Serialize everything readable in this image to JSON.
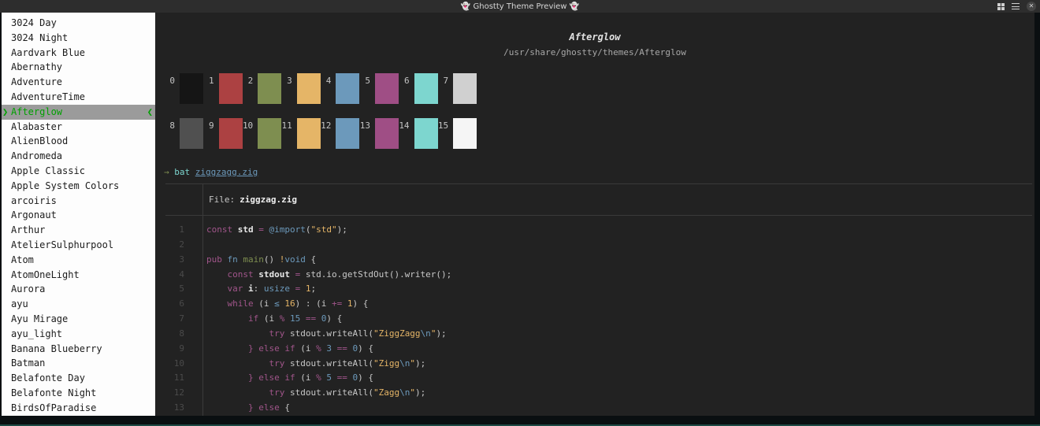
{
  "titlebar": {
    "title": "👻 Ghostty Theme Preview 👻"
  },
  "colors": {
    "titlebar_bg": "#2d2d2d",
    "sidebar_bg": "#fdfdfd",
    "term_bg": "#222222",
    "select_bg": "#9b9b9b",
    "select_green": "#00a000",
    "rule": "#3a3a3a",
    "line_number": "#4a4a4a",
    "plain": "#c8c8c8",
    "bright": "#e8e8e8",
    "magenta": "#a0558a",
    "blue": "#6c99bb",
    "yellow": "#e5b567",
    "green": "#7e8e50",
    "cyan": "#7dd6cf"
  },
  "sidebar": {
    "selected_index": 6,
    "selection_marker_left": "❯",
    "selection_marker_right": "❮",
    "items": [
      "3024 Day",
      "3024 Night",
      "Aardvark Blue",
      "Abernathy",
      "Adventure",
      "AdventureTime",
      "Afterglow",
      "Alabaster",
      "AlienBlood",
      "Andromeda",
      "Apple Classic",
      "Apple System Colors",
      "arcoiris",
      "Argonaut",
      "Arthur",
      "AtelierSulphurpool",
      "Atom",
      "AtomOneLight",
      "Aurora",
      "ayu",
      "Ayu Mirage",
      "ayu_light",
      "Banana Blueberry",
      "Batman",
      "Belafonte Day",
      "Belafonte Night",
      "BirdsOfParadise"
    ]
  },
  "preview": {
    "theme_name": "Afterglow",
    "theme_path": "/usr/share/ghostty/themes/Afterglow",
    "palette": [
      {
        "index": 0,
        "hex": "#151515"
      },
      {
        "index": 1,
        "hex": "#ac4142"
      },
      {
        "index": 2,
        "hex": "#7e8e50"
      },
      {
        "index": 3,
        "hex": "#e5b567"
      },
      {
        "index": 4,
        "hex": "#6c99bb"
      },
      {
        "index": 5,
        "hex": "#9f4e85"
      },
      {
        "index": 6,
        "hex": "#7dd6cf"
      },
      {
        "index": 7,
        "hex": "#d0d0d0"
      },
      {
        "index": 8,
        "hex": "#505050"
      },
      {
        "index": 9,
        "hex": "#ac4142"
      },
      {
        "index": 10,
        "hex": "#7e8e50"
      },
      {
        "index": 11,
        "hex": "#e5b567"
      },
      {
        "index": 12,
        "hex": "#6c99bb"
      },
      {
        "index": 13,
        "hex": "#9f4e85"
      },
      {
        "index": 14,
        "hex": "#7dd6cf"
      },
      {
        "index": 15,
        "hex": "#f5f5f5"
      }
    ],
    "prompt": {
      "arrow": "→",
      "command": " bat ",
      "arg": "ziggzagg.zig"
    },
    "bat": {
      "file_label": "File:",
      "file_name": "ziggzag.zig",
      "code_lines": [
        {
          "n": "1",
          "tokens": [
            [
              "m",
              "const"
            ],
            [
              "wb",
              " std "
            ],
            [
              "m",
              "="
            ],
            [
              "w",
              " "
            ],
            [
              "b",
              "@import"
            ],
            [
              "w",
              "("
            ],
            [
              "y",
              "\"std\""
            ],
            [
              "w",
              ");"
            ]
          ]
        },
        {
          "n": "2",
          "tokens": []
        },
        {
          "n": "3",
          "tokens": [
            [
              "m",
              "pub"
            ],
            [
              "w",
              " "
            ],
            [
              "b",
              "fn"
            ],
            [
              "w",
              " "
            ],
            [
              "g",
              "main"
            ],
            [
              "w",
              "() "
            ],
            [
              "y",
              "!"
            ],
            [
              "b",
              "void"
            ],
            [
              "w",
              " {"
            ]
          ]
        },
        {
          "n": "4",
          "tokens": [
            [
              "w",
              "    "
            ],
            [
              "m",
              "const"
            ],
            [
              "wb",
              " stdout "
            ],
            [
              "m",
              "="
            ],
            [
              "w",
              " std.io.getStdOut().writer();"
            ]
          ]
        },
        {
          "n": "5",
          "tokens": [
            [
              "w",
              "    "
            ],
            [
              "m",
              "var"
            ],
            [
              "wb",
              " i"
            ],
            [
              "w",
              ": "
            ],
            [
              "b",
              "usize"
            ],
            [
              "w",
              " "
            ],
            [
              "m",
              "="
            ],
            [
              "w",
              " "
            ],
            [
              "y",
              "1"
            ],
            [
              "w",
              ";"
            ]
          ]
        },
        {
          "n": "6",
          "tokens": [
            [
              "w",
              "    "
            ],
            [
              "m",
              "while"
            ],
            [
              "w",
              " (i "
            ],
            [
              "b",
              "≤"
            ],
            [
              "w",
              " "
            ],
            [
              "y",
              "16"
            ],
            [
              "w",
              ") : (i "
            ],
            [
              "m",
              "+="
            ],
            [
              "w",
              " "
            ],
            [
              "y",
              "1"
            ],
            [
              "w",
              ") {"
            ]
          ]
        },
        {
          "n": "7",
          "tokens": [
            [
              "w",
              "        "
            ],
            [
              "m",
              "if"
            ],
            [
              "w",
              " (i "
            ],
            [
              "m",
              "%"
            ],
            [
              "w",
              " "
            ],
            [
              "b",
              "15"
            ],
            [
              "w",
              " "
            ],
            [
              "m",
              "=="
            ],
            [
              "w",
              " "
            ],
            [
              "b",
              "0"
            ],
            [
              "w",
              ") {"
            ]
          ]
        },
        {
          "n": "8",
          "tokens": [
            [
              "w",
              "            "
            ],
            [
              "m",
              "try"
            ],
            [
              "w",
              " stdout.writeAll("
            ],
            [
              "y",
              "\"ZiggZagg"
            ],
            [
              "b",
              "\\n"
            ],
            [
              "y",
              "\""
            ],
            [
              "w",
              ");"
            ]
          ]
        },
        {
          "n": "9",
          "tokens": [
            [
              "w",
              "        "
            ],
            [
              "m",
              "} else if"
            ],
            [
              "w",
              " (i "
            ],
            [
              "m",
              "%"
            ],
            [
              "w",
              " "
            ],
            [
              "b",
              "3"
            ],
            [
              "w",
              " "
            ],
            [
              "m",
              "=="
            ],
            [
              "w",
              " "
            ],
            [
              "b",
              "0"
            ],
            [
              "w",
              ") {"
            ]
          ]
        },
        {
          "n": "10",
          "tokens": [
            [
              "w",
              "            "
            ],
            [
              "m",
              "try"
            ],
            [
              "w",
              " stdout.writeAll("
            ],
            [
              "y",
              "\"Zigg"
            ],
            [
              "b",
              "\\n"
            ],
            [
              "y",
              "\""
            ],
            [
              "w",
              ");"
            ]
          ]
        },
        {
          "n": "11",
          "tokens": [
            [
              "w",
              "        "
            ],
            [
              "m",
              "} else if"
            ],
            [
              "w",
              " (i "
            ],
            [
              "m",
              "%"
            ],
            [
              "w",
              " "
            ],
            [
              "b",
              "5"
            ],
            [
              "w",
              " "
            ],
            [
              "m",
              "=="
            ],
            [
              "w",
              " "
            ],
            [
              "b",
              "0"
            ],
            [
              "w",
              ") {"
            ]
          ]
        },
        {
          "n": "12",
          "tokens": [
            [
              "w",
              "            "
            ],
            [
              "m",
              "try"
            ],
            [
              "w",
              " stdout.writeAll("
            ],
            [
              "y",
              "\"Zagg"
            ],
            [
              "b",
              "\\n"
            ],
            [
              "y",
              "\""
            ],
            [
              "w",
              ");"
            ]
          ]
        },
        {
          "n": "13",
          "tokens": [
            [
              "w",
              "        "
            ],
            [
              "m",
              "} else"
            ],
            [
              "w",
              " {"
            ]
          ]
        }
      ]
    }
  }
}
